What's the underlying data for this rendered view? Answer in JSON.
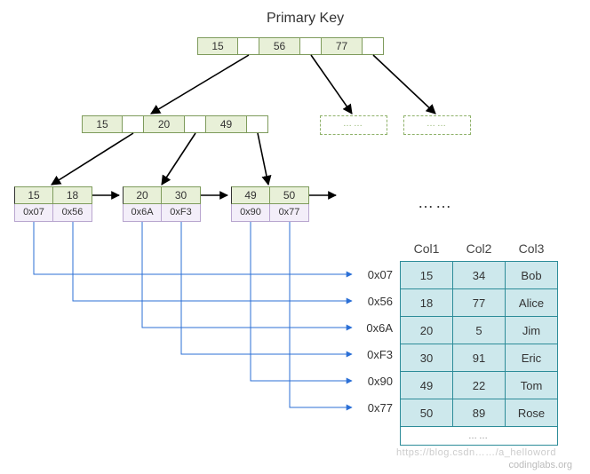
{
  "title": "Primary Key",
  "root": {
    "keys": [
      "15",
      "56",
      "77"
    ]
  },
  "internal": {
    "keys": [
      "15",
      "20",
      "49"
    ]
  },
  "ghosts": [
    "……",
    "……"
  ],
  "leaves": [
    {
      "keys": [
        "15",
        "18"
      ],
      "ptrs": [
        "0x07",
        "0x56"
      ]
    },
    {
      "keys": [
        "20",
        "30"
      ],
      "ptrs": [
        "0x6A",
        "0xF3"
      ]
    },
    {
      "keys": [
        "49",
        "50"
      ],
      "ptrs": [
        "0x90",
        "0x77"
      ]
    }
  ],
  "leaf_ellipsis": "……",
  "addresses": [
    "0x07",
    "0x56",
    "0x6A",
    "0xF3",
    "0x90",
    "0x77"
  ],
  "table": {
    "headers": [
      "Col1",
      "Col2",
      "Col3"
    ],
    "rows": [
      [
        "15",
        "34",
        "Bob"
      ],
      [
        "18",
        "77",
        "Alice"
      ],
      [
        "20",
        "5",
        "Jim"
      ],
      [
        "30",
        "91",
        "Eric"
      ],
      [
        "49",
        "22",
        "Tom"
      ],
      [
        "50",
        "89",
        "Rose"
      ]
    ],
    "footer": "……"
  },
  "watermark1": "https://blog.csdn……/a_helloword",
  "watermark2": "codinglabs.org",
  "chart_data": {
    "type": "table",
    "description": "B+ tree primary key index pointing to data rows",
    "index_root_keys": [
      15,
      56,
      77
    ],
    "index_internal_keys": [
      15,
      20,
      49
    ],
    "index_leaves": [
      {
        "keys": [
          15,
          18
        ],
        "pointers": [
          "0x07",
          "0x56"
        ]
      },
      {
        "keys": [
          20,
          30
        ],
        "pointers": [
          "0x6A",
          "0xF3"
        ]
      },
      {
        "keys": [
          49,
          50
        ],
        "pointers": [
          "0x90",
          "0x77"
        ]
      }
    ],
    "columns": [
      "Col1",
      "Col2",
      "Col3"
    ],
    "rows_by_pointer": {
      "0x07": [
        15,
        34,
        "Bob"
      ],
      "0x56": [
        18,
        77,
        "Alice"
      ],
      "0x6A": [
        20,
        5,
        "Jim"
      ],
      "0xF3": [
        30,
        91,
        "Eric"
      ],
      "0x90": [
        49,
        22,
        "Tom"
      ],
      "0x77": [
        50,
        89,
        "Rose"
      ]
    }
  }
}
